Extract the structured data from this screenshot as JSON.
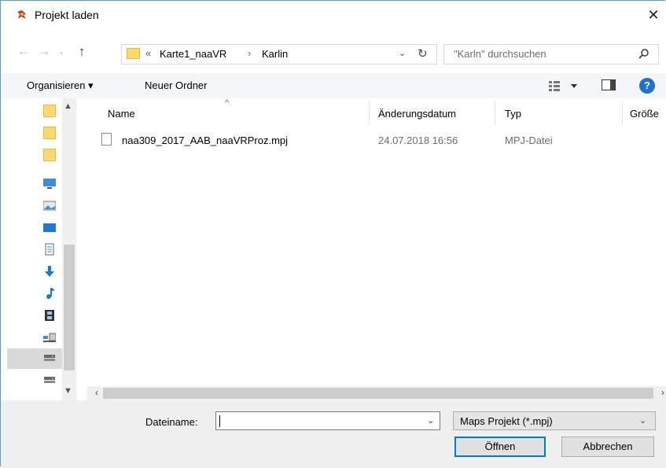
{
  "window": {
    "title": "Projekt laden",
    "close_label": "✕"
  },
  "address": {
    "crumbs": [
      "Karte1_naaVR",
      "Karlin"
    ],
    "overflow": "«",
    "separator": "›"
  },
  "search": {
    "placeholder": "\"Karln\" durchsuchen"
  },
  "toolbar": {
    "organize_label": "Organisieren ▾",
    "new_folder_label": "Neuer Ordner",
    "help_label": "?"
  },
  "columns": {
    "name": "Name",
    "date": "Änderungsdatum",
    "type": "Typ",
    "size": "Größe"
  },
  "files": [
    {
      "name": "naa309_2017_AAB_naaVRProz.mpj",
      "date": "24.07.2018 16:56",
      "type": "MPJ-Datei"
    }
  ],
  "nav_icons": [
    "folder-icon",
    "folder-icon",
    "folder-icon",
    "desktop-icon",
    "pictures-icon",
    "desktop-folder-icon",
    "documents-icon",
    "downloads-icon",
    "music-icon",
    "videos-icon",
    "network-drive-icon",
    "drive-icon",
    "drive-icon"
  ],
  "bottom": {
    "filename_label": "Dateiname:",
    "filename_value": "",
    "filter_value": "Maps Projekt (*.mpj)",
    "open_label": "Öffnen",
    "cancel_label": "Abbrechen"
  },
  "colors": {
    "accent": "#0078d7",
    "folder": "#ffd86b",
    "help": "#1e6fd6"
  }
}
